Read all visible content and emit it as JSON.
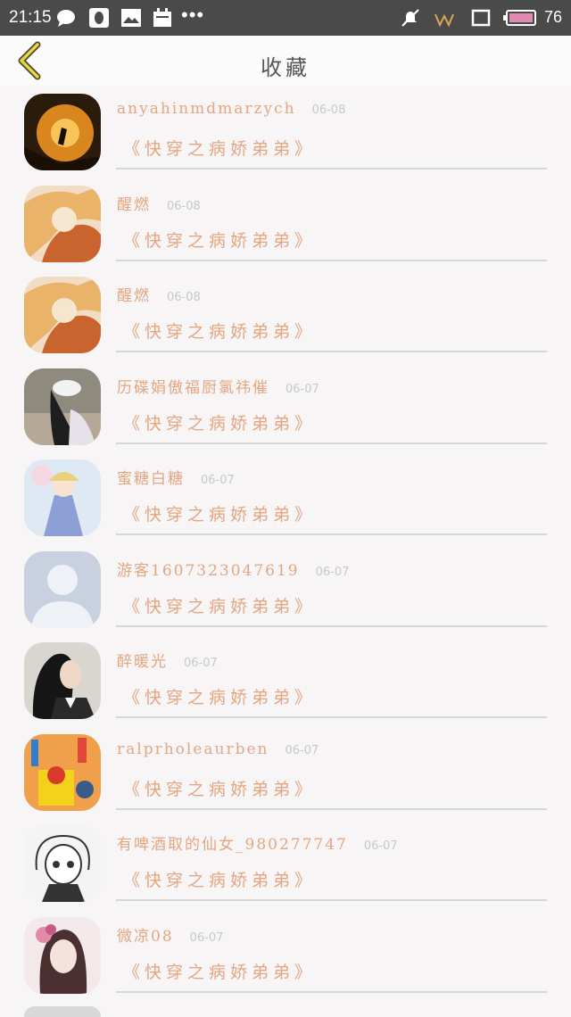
{
  "status_bar": {
    "time": "21:15",
    "battery": "76"
  },
  "header": {
    "title": "收藏"
  },
  "list": [
    {
      "name": "anyahinmdmarzych",
      "date": "06-08",
      "book": "《快穿之病娇弟弟》"
    },
    {
      "name": "醒燃",
      "date": "06-08",
      "book": "《快穿之病娇弟弟》"
    },
    {
      "name": "醒燃",
      "date": "06-08",
      "book": "《快穿之病娇弟弟》"
    },
    {
      "name": "历碟娟傲福厨氯祎催",
      "date": "06-07",
      "book": "《快穿之病娇弟弟》"
    },
    {
      "name": "蜜糖白糖",
      "date": "06-07",
      "book": "《快穿之病娇弟弟》"
    },
    {
      "name": "游客1607323047619",
      "date": "06-07",
      "book": "《快穿之病娇弟弟》"
    },
    {
      "name": "醉暖光",
      "date": "06-07",
      "book": "《快穿之病娇弟弟》"
    },
    {
      "name": "ralprholeaurben",
      "date": "06-07",
      "book": "《快穿之病娇弟弟》"
    },
    {
      "name": "有啤酒取的仙女_980277747",
      "date": "06-07",
      "book": "《快穿之病娇弟弟》"
    },
    {
      "name": "微凉08",
      "date": "06-07",
      "book": "《快穿之病娇弟弟》"
    }
  ]
}
